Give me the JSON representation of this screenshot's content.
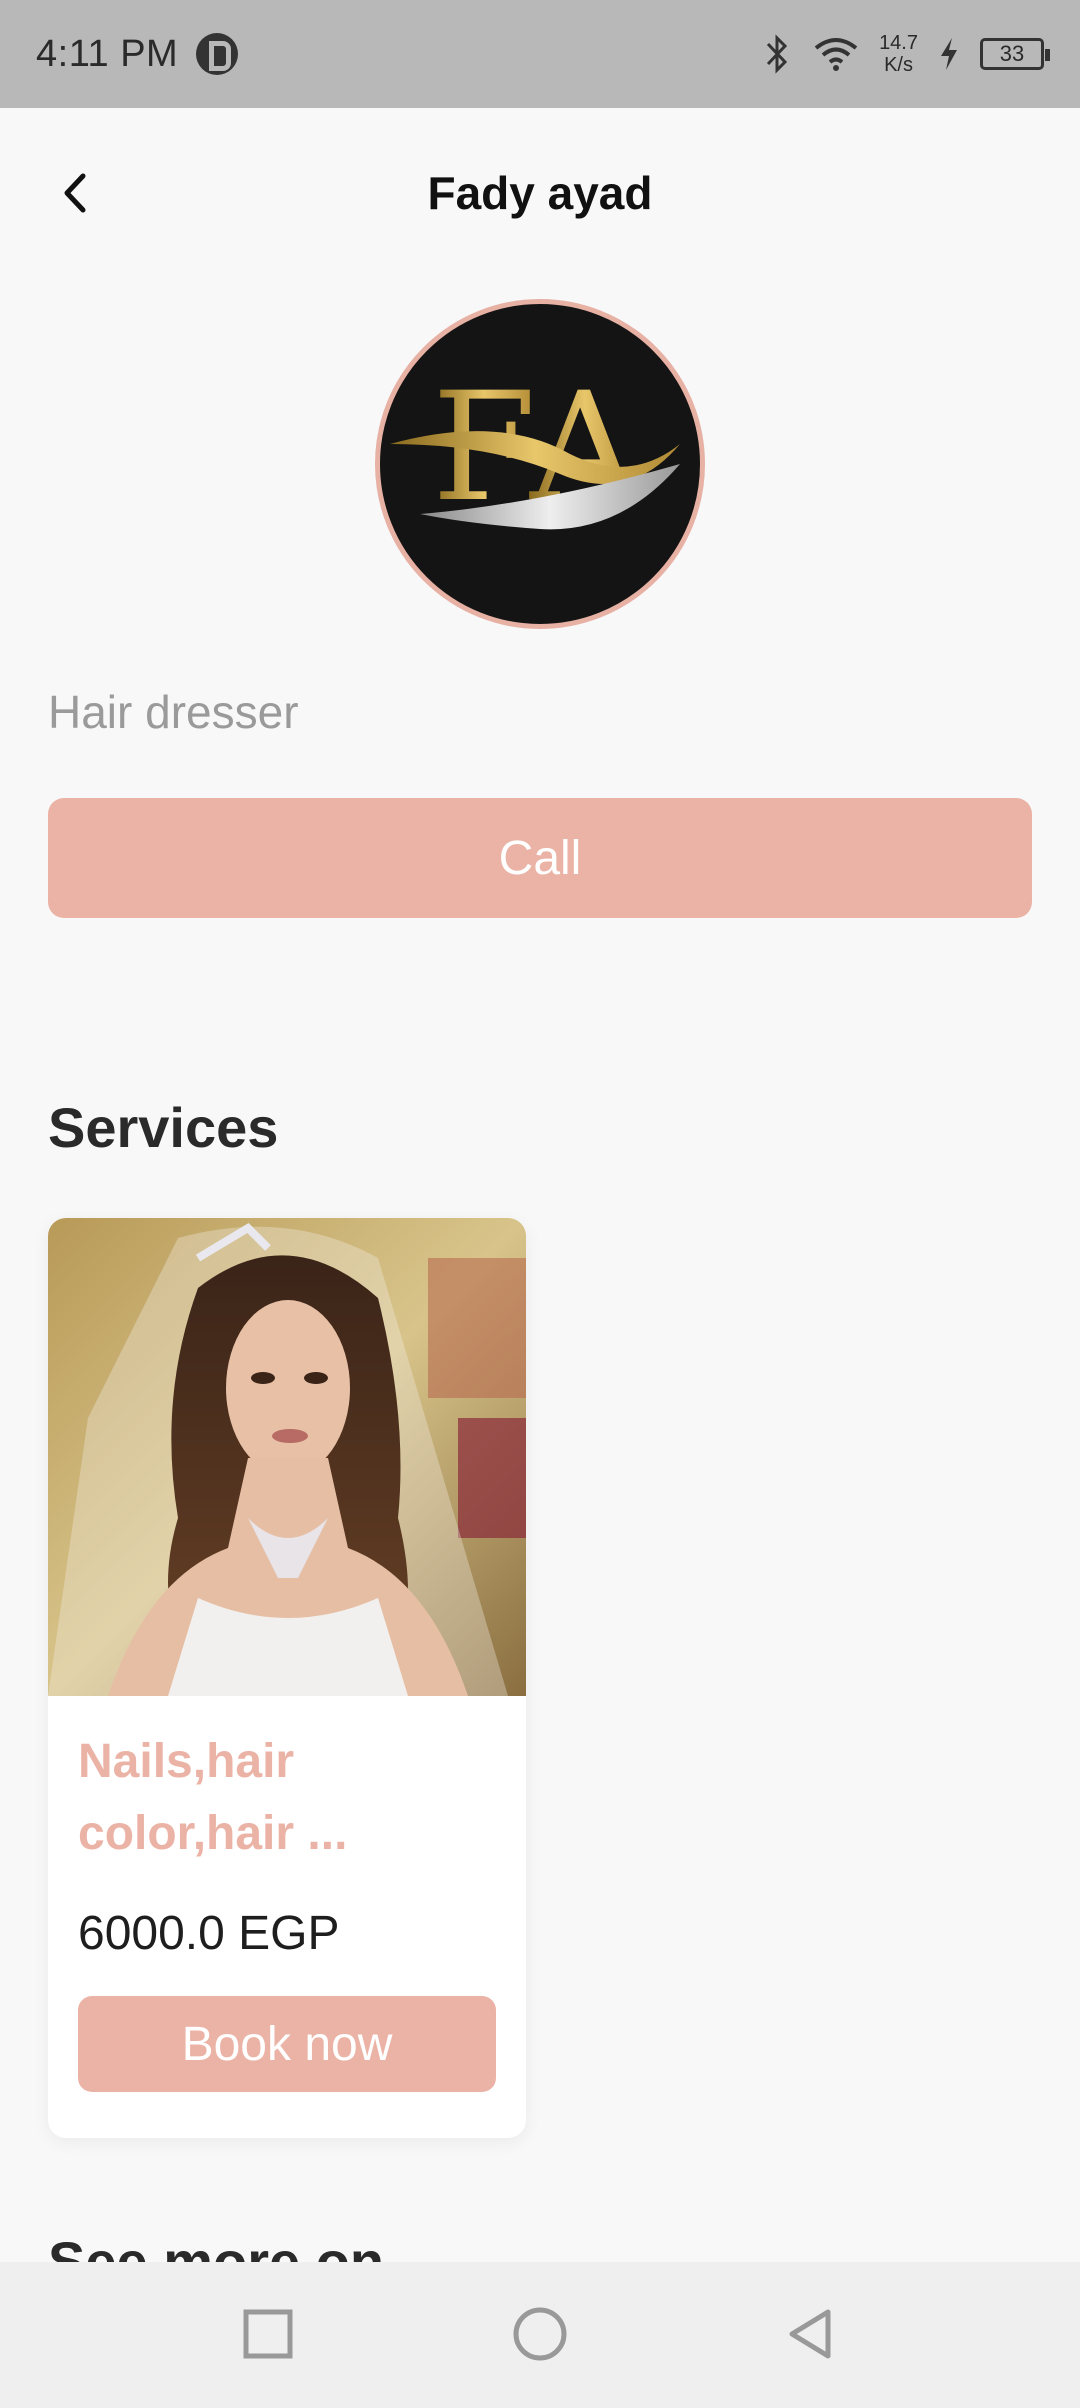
{
  "status_bar": {
    "time": "4:11 PM",
    "speed_value": "14.7",
    "speed_unit": "K/s",
    "battery": "33"
  },
  "header": {
    "title": "Fady ayad"
  },
  "profile": {
    "profession": "Hair dresser",
    "call_label": "Call",
    "avatar_logo": "FA"
  },
  "services": {
    "title": "Services",
    "items": [
      {
        "name": "Nails,hair color,hair ...",
        "price": "6000.0 EGP",
        "book_label": "Book now"
      }
    ]
  },
  "see_more": {
    "title": "See more on"
  },
  "colors": {
    "accent": "#ebb3a6",
    "background": "#f8f8f8",
    "status_bar": "#b8b8b8",
    "nav_bar": "#efefef"
  },
  "icons": {
    "back": "chevron-left-icon",
    "bluetooth": "bluetooth-icon",
    "wifi": "wifi-icon",
    "charging": "charging-icon",
    "nav_recents": "square-icon",
    "nav_home": "circle-icon",
    "nav_back": "triangle-back-icon"
  }
}
